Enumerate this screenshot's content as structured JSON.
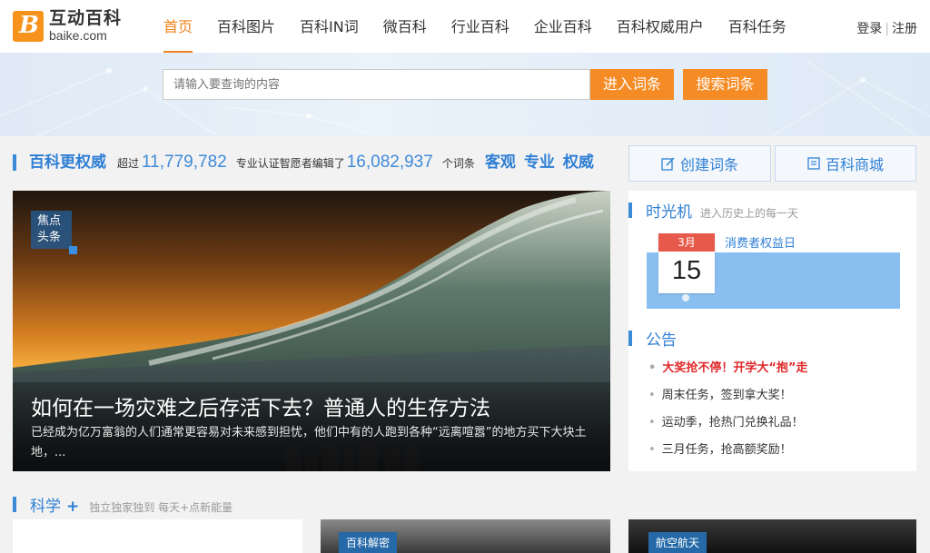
{
  "header": {
    "logo_cn": "互动百科",
    "logo_en": "baike.com",
    "logo_mark": "B",
    "nav": [
      "首页",
      "百科图片",
      "百科IN词",
      "微百科",
      "行业百科",
      "企业百科",
      "百科权威用户",
      "百科任务"
    ],
    "login": "登录",
    "separator": "|",
    "register": "注册"
  },
  "search": {
    "placeholder": "请输入要查询的内容",
    "enter_btn": "进入词条",
    "search_btn": "搜索词条"
  },
  "stats": {
    "title": "百科更权威",
    "prefix": "超过",
    "editors": "11,779,782",
    "middle": "专业认证智愿者编辑了",
    "entries": "16,082,937",
    "suffix": "个词条",
    "keywords": [
      "客观",
      "专业",
      "权威"
    ]
  },
  "side_buttons": {
    "create": "创建词条",
    "mall": "百科商城"
  },
  "hero": {
    "badge_line1": "焦点",
    "badge_line2": "头条",
    "title": "如何在一场灾难之后存活下去？普通人的生存方法",
    "desc": "已经成为亿万富翁的人们通常更容易对未来感到担忧，他们中有的人跑到各种“远离喧嚣”的地方买下大块土地，..."
  },
  "time_machine": {
    "title": "时光机",
    "subtitle": "进入历史上的每一天",
    "month": "3月",
    "day": "15",
    "event": "消费者权益日"
  },
  "notice": {
    "title": "公告",
    "items": [
      "大奖抢不停！开学大“抱”走",
      "周末任务，签到拿大奖！",
      "运动季，抢热门兑换礼品！",
      "三月任务，抢高额奖励！"
    ]
  },
  "science": {
    "title": "科学",
    "plus": "+",
    "subtitle": "独立独家独到 每天+点新能量",
    "card_tags": [
      "百科解密",
      "航空航天"
    ]
  },
  "colors": {
    "accent_orange": "#f58b25",
    "brand_blue": "#2f7fd4",
    "hot_red": "#e0292b"
  }
}
